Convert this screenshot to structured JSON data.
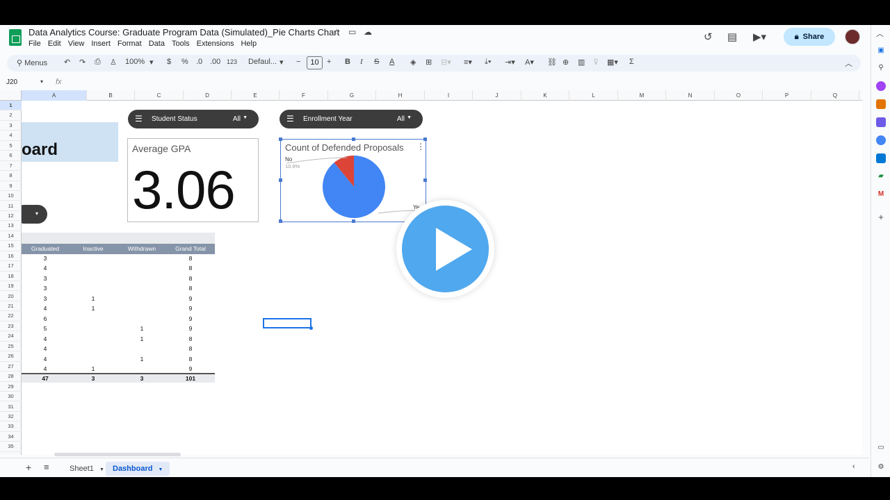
{
  "doc": {
    "title": "Data Analytics Course: Graduate Program Data (Simulated)_Pie Charts Chart",
    "share_label": "Share"
  },
  "menu": [
    "File",
    "Edit",
    "View",
    "Insert",
    "Format",
    "Data",
    "Tools",
    "Extensions",
    "Help"
  ],
  "toolbar": {
    "menus_label": "Menus",
    "zoom": "100%",
    "currency": "$",
    "percent": "%",
    "dec_less": ".0",
    "dec_more": ".00",
    "number_format": "123",
    "font": "Defaul...",
    "font_size": "10",
    "bold": "B",
    "italic": "I"
  },
  "formula_bar": {
    "cell_ref": "J20",
    "fx": "fx"
  },
  "columns": [
    "A",
    "B",
    "C",
    "D",
    "E",
    "F",
    "G",
    "H",
    "I",
    "J",
    "K",
    "L",
    "M",
    "N",
    "O",
    "P",
    "Q"
  ],
  "rows": [
    "1",
    "2",
    "3",
    "4",
    "5",
    "6",
    "7",
    "8",
    "9",
    "10",
    "11",
    "12",
    "13",
    "14",
    "15",
    "16",
    "17",
    "18",
    "19",
    "20",
    "21",
    "22",
    "23",
    "24",
    "25",
    "26",
    "27",
    "28",
    "29",
    "30",
    "31",
    "32",
    "33",
    "34",
    "35"
  ],
  "dashboard": {
    "title_fragment": "oard",
    "filters": [
      {
        "label": "Student Status",
        "value": "All"
      },
      {
        "label": "Enrollment Year",
        "value": "All"
      }
    ],
    "scorecard": {
      "label": "Average GPA",
      "value": "3.06"
    },
    "pie_chart": {
      "title": "Count of Defended Proposals",
      "no_label": "No",
      "no_pct": "10.9%",
      "yes_label": "Ye"
    }
  },
  "chart_data": {
    "type": "pie",
    "title": "Count of Defended Proposals",
    "categories": [
      "No",
      "Yes"
    ],
    "values": [
      10.9,
      89.1
    ],
    "colors": [
      "#db4437",
      "#4285f4"
    ]
  },
  "pivot": {
    "headers": [
      "Graduated",
      "Inactive",
      "Withdrawn",
      "Grand Total"
    ],
    "rows": [
      [
        "3",
        "",
        "",
        "8"
      ],
      [
        "4",
        "",
        "",
        "8"
      ],
      [
        "3",
        "",
        "",
        "8"
      ],
      [
        "3",
        "",
        "",
        "8"
      ],
      [
        "3",
        "1",
        "",
        "9"
      ],
      [
        "4",
        "1",
        "",
        "9"
      ],
      [
        "6",
        "",
        "",
        "9"
      ],
      [
        "5",
        "",
        "1",
        "9"
      ],
      [
        "4",
        "",
        "1",
        "8"
      ],
      [
        "4",
        "",
        "",
        "8"
      ],
      [
        "4",
        "",
        "1",
        "8"
      ],
      [
        "4",
        "1",
        "",
        "9"
      ]
    ],
    "totals": [
      "47",
      "3",
      "3",
      "101"
    ]
  },
  "tabs": {
    "sheet1": "Sheet1",
    "dashboard": "Dashboard"
  },
  "colors": {
    "accent": "#1a73e8",
    "share_bg": "#c2e7ff",
    "pivot_header": "#8594a8",
    "play": "#50a8ee"
  }
}
